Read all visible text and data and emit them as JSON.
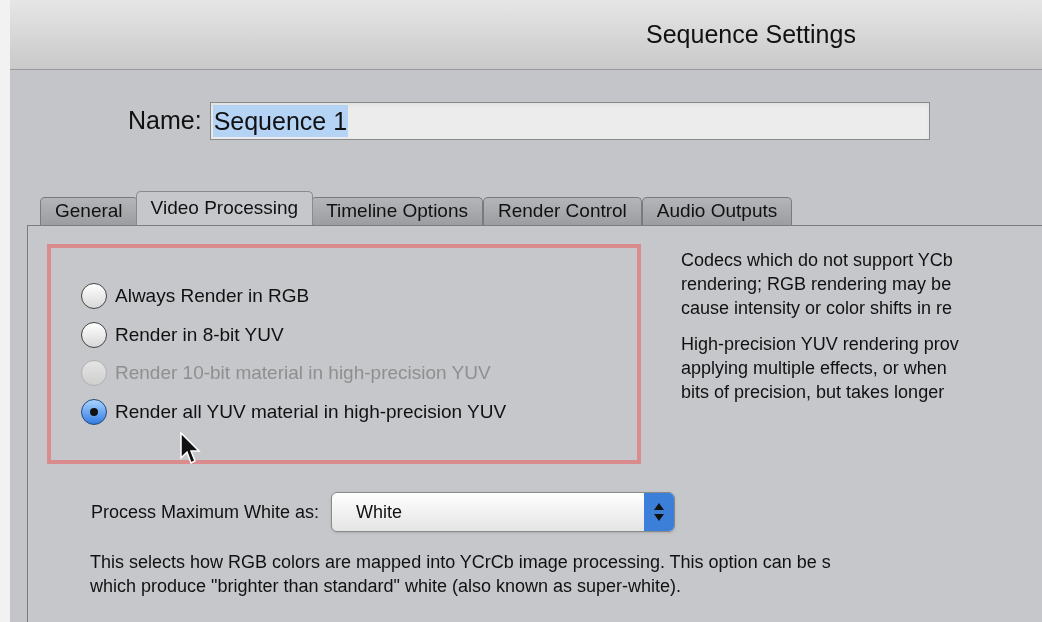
{
  "window": {
    "title": "Sequence Settings"
  },
  "name_field": {
    "label": "Name:",
    "value": "Sequence 1"
  },
  "tabs": [
    {
      "label": "General",
      "selected": false
    },
    {
      "label": "Video Processing",
      "selected": true
    },
    {
      "label": "Timeline Options",
      "selected": false
    },
    {
      "label": "Render Control",
      "selected": false
    },
    {
      "label": "Audio Outputs",
      "selected": false
    }
  ],
  "render_options": [
    {
      "label": "Always Render in RGB",
      "selected": false,
      "disabled": false
    },
    {
      "label": "Render in 8-bit YUV",
      "selected": false,
      "disabled": false
    },
    {
      "label": "Render 10-bit material in high-precision YUV",
      "selected": false,
      "disabled": true
    },
    {
      "label": "Render all YUV material in high-precision YUV",
      "selected": true,
      "disabled": false
    }
  ],
  "help_paragraphs": [
    [
      "Codecs which do not support YCb",
      "rendering; RGB rendering may be",
      "cause intensity or color shifts in re"
    ],
    [
      "High-precision YUV rendering prov",
      "applying multiple effects, or when",
      "bits of precision, but takes longer"
    ]
  ],
  "max_white": {
    "label": "Process Maximum White as:",
    "value": "White"
  },
  "description": [
    "This selects how RGB colors are mapped into YCrCb image processing. This option can be s",
    "which produce \"brighter than standard\" white (also known as super-white)."
  ]
}
